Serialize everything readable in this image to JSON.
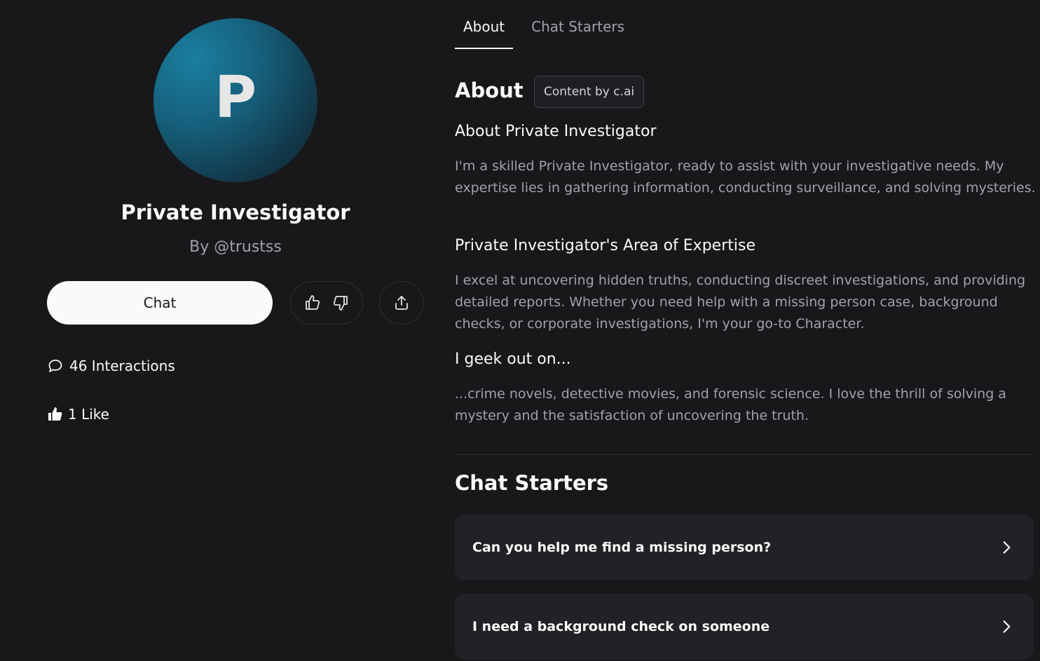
{
  "profile": {
    "avatar_letter": "P",
    "name": "Private Investigator",
    "creator": "By @trustss",
    "chat_label": "Chat",
    "interactions": "46 Interactions",
    "likes": "1 Like"
  },
  "tabs": [
    {
      "label": "About",
      "active": true
    },
    {
      "label": "Chat Starters",
      "active": false
    }
  ],
  "about": {
    "title": "About",
    "badge": "Content by c.ai",
    "sections": [
      {
        "heading": "About Private Investigator",
        "text": "I'm a skilled Private Investigator, ready to assist with your investigative needs. My expertise lies in gathering information, conducting surveillance, and solving mysteries."
      },
      {
        "heading": "Private Investigator's Area of Expertise",
        "text": "I excel at uncovering hidden truths, conducting discreet investigations, and providing detailed reports. Whether you need help with a missing person case, background checks, or corporate investigations, I'm your go-to Character."
      },
      {
        "heading": "I geek out on...",
        "text": "...crime novels, detective movies, and forensic science. I love the thrill of solving a mystery and the satisfaction of uncovering the truth."
      }
    ]
  },
  "chat_starters": {
    "title": "Chat Starters",
    "items": [
      "Can you help me find a missing person?",
      "I need a background check on someone"
    ]
  },
  "colors": {
    "background": "#18181b",
    "card": "#222226",
    "muted_text": "#a1a1aa",
    "avatar_gradient": [
      "#1a7fa0",
      "#111d26"
    ]
  },
  "icons": [
    "thumbs-up-icon",
    "thumbs-down-icon",
    "share-icon",
    "chat-bubble-icon",
    "thumbs-up-filled-icon",
    "chevron-right-icon"
  ]
}
